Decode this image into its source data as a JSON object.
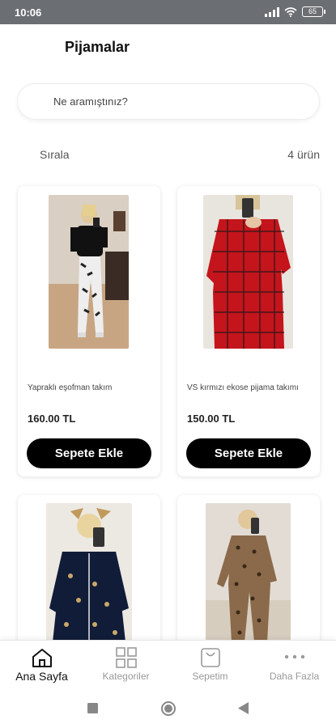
{
  "status": {
    "time": "10:06",
    "battery": "65"
  },
  "header": {
    "title": "Pijamalar"
  },
  "search": {
    "placeholder": "Ne aramıştınız?"
  },
  "toolbar": {
    "sort_label": "Sırala",
    "count_label": "4 ürün"
  },
  "products": [
    {
      "name": "Yapraklı eşofman takım",
      "price": "160.00 TL",
      "button": "Sepete Ekle"
    },
    {
      "name": "VS kırmızı ekose pijama takımı",
      "price": "150.00 TL",
      "button": "Sepete Ekle"
    },
    {
      "name": "",
      "price": "",
      "button": ""
    },
    {
      "name": "",
      "price": "",
      "button": ""
    }
  ],
  "bottom_nav": [
    {
      "label": "Ana Sayfa",
      "icon": "home-icon",
      "active": true
    },
    {
      "label": "Kategoriler",
      "icon": "grid-icon",
      "active": false
    },
    {
      "label": "Sepetim",
      "icon": "shopping-bag-icon",
      "active": false
    },
    {
      "label": "Daha Fazla",
      "icon": "more-icon",
      "active": false
    }
  ],
  "colors": {
    "accent": "#000000",
    "status_bar": "#6b6e72",
    "muted": "#999999"
  }
}
